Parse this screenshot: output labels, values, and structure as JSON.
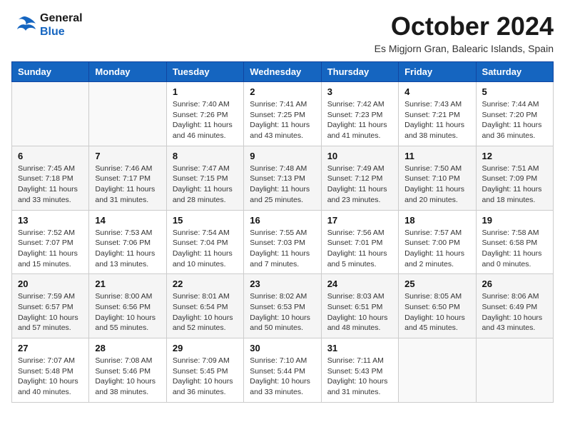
{
  "logo": {
    "line1": "General",
    "line2": "Blue"
  },
  "title": "October 2024",
  "location": "Es Migjorn Gran, Balearic Islands, Spain",
  "headers": [
    "Sunday",
    "Monday",
    "Tuesday",
    "Wednesday",
    "Thursday",
    "Friday",
    "Saturday"
  ],
  "weeks": [
    [
      {
        "day": "",
        "info": ""
      },
      {
        "day": "",
        "info": ""
      },
      {
        "day": "1",
        "info": "Sunrise: 7:40 AM\nSunset: 7:26 PM\nDaylight: 11 hours and 46 minutes."
      },
      {
        "day": "2",
        "info": "Sunrise: 7:41 AM\nSunset: 7:25 PM\nDaylight: 11 hours and 43 minutes."
      },
      {
        "day": "3",
        "info": "Sunrise: 7:42 AM\nSunset: 7:23 PM\nDaylight: 11 hours and 41 minutes."
      },
      {
        "day": "4",
        "info": "Sunrise: 7:43 AM\nSunset: 7:21 PM\nDaylight: 11 hours and 38 minutes."
      },
      {
        "day": "5",
        "info": "Sunrise: 7:44 AM\nSunset: 7:20 PM\nDaylight: 11 hours and 36 minutes."
      }
    ],
    [
      {
        "day": "6",
        "info": "Sunrise: 7:45 AM\nSunset: 7:18 PM\nDaylight: 11 hours and 33 minutes."
      },
      {
        "day": "7",
        "info": "Sunrise: 7:46 AM\nSunset: 7:17 PM\nDaylight: 11 hours and 31 minutes."
      },
      {
        "day": "8",
        "info": "Sunrise: 7:47 AM\nSunset: 7:15 PM\nDaylight: 11 hours and 28 minutes."
      },
      {
        "day": "9",
        "info": "Sunrise: 7:48 AM\nSunset: 7:13 PM\nDaylight: 11 hours and 25 minutes."
      },
      {
        "day": "10",
        "info": "Sunrise: 7:49 AM\nSunset: 7:12 PM\nDaylight: 11 hours and 23 minutes."
      },
      {
        "day": "11",
        "info": "Sunrise: 7:50 AM\nSunset: 7:10 PM\nDaylight: 11 hours and 20 minutes."
      },
      {
        "day": "12",
        "info": "Sunrise: 7:51 AM\nSunset: 7:09 PM\nDaylight: 11 hours and 18 minutes."
      }
    ],
    [
      {
        "day": "13",
        "info": "Sunrise: 7:52 AM\nSunset: 7:07 PM\nDaylight: 11 hours and 15 minutes."
      },
      {
        "day": "14",
        "info": "Sunrise: 7:53 AM\nSunset: 7:06 PM\nDaylight: 11 hours and 13 minutes."
      },
      {
        "day": "15",
        "info": "Sunrise: 7:54 AM\nSunset: 7:04 PM\nDaylight: 11 hours and 10 minutes."
      },
      {
        "day": "16",
        "info": "Sunrise: 7:55 AM\nSunset: 7:03 PM\nDaylight: 11 hours and 7 minutes."
      },
      {
        "day": "17",
        "info": "Sunrise: 7:56 AM\nSunset: 7:01 PM\nDaylight: 11 hours and 5 minutes."
      },
      {
        "day": "18",
        "info": "Sunrise: 7:57 AM\nSunset: 7:00 PM\nDaylight: 11 hours and 2 minutes."
      },
      {
        "day": "19",
        "info": "Sunrise: 7:58 AM\nSunset: 6:58 PM\nDaylight: 11 hours and 0 minutes."
      }
    ],
    [
      {
        "day": "20",
        "info": "Sunrise: 7:59 AM\nSunset: 6:57 PM\nDaylight: 10 hours and 57 minutes."
      },
      {
        "day": "21",
        "info": "Sunrise: 8:00 AM\nSunset: 6:56 PM\nDaylight: 10 hours and 55 minutes."
      },
      {
        "day": "22",
        "info": "Sunrise: 8:01 AM\nSunset: 6:54 PM\nDaylight: 10 hours and 52 minutes."
      },
      {
        "day": "23",
        "info": "Sunrise: 8:02 AM\nSunset: 6:53 PM\nDaylight: 10 hours and 50 minutes."
      },
      {
        "day": "24",
        "info": "Sunrise: 8:03 AM\nSunset: 6:51 PM\nDaylight: 10 hours and 48 minutes."
      },
      {
        "day": "25",
        "info": "Sunrise: 8:05 AM\nSunset: 6:50 PM\nDaylight: 10 hours and 45 minutes."
      },
      {
        "day": "26",
        "info": "Sunrise: 8:06 AM\nSunset: 6:49 PM\nDaylight: 10 hours and 43 minutes."
      }
    ],
    [
      {
        "day": "27",
        "info": "Sunrise: 7:07 AM\nSunset: 5:48 PM\nDaylight: 10 hours and 40 minutes."
      },
      {
        "day": "28",
        "info": "Sunrise: 7:08 AM\nSunset: 5:46 PM\nDaylight: 10 hours and 38 minutes."
      },
      {
        "day": "29",
        "info": "Sunrise: 7:09 AM\nSunset: 5:45 PM\nDaylight: 10 hours and 36 minutes."
      },
      {
        "day": "30",
        "info": "Sunrise: 7:10 AM\nSunset: 5:44 PM\nDaylight: 10 hours and 33 minutes."
      },
      {
        "day": "31",
        "info": "Sunrise: 7:11 AM\nSunset: 5:43 PM\nDaylight: 10 hours and 31 minutes."
      },
      {
        "day": "",
        "info": ""
      },
      {
        "day": "",
        "info": ""
      }
    ]
  ]
}
